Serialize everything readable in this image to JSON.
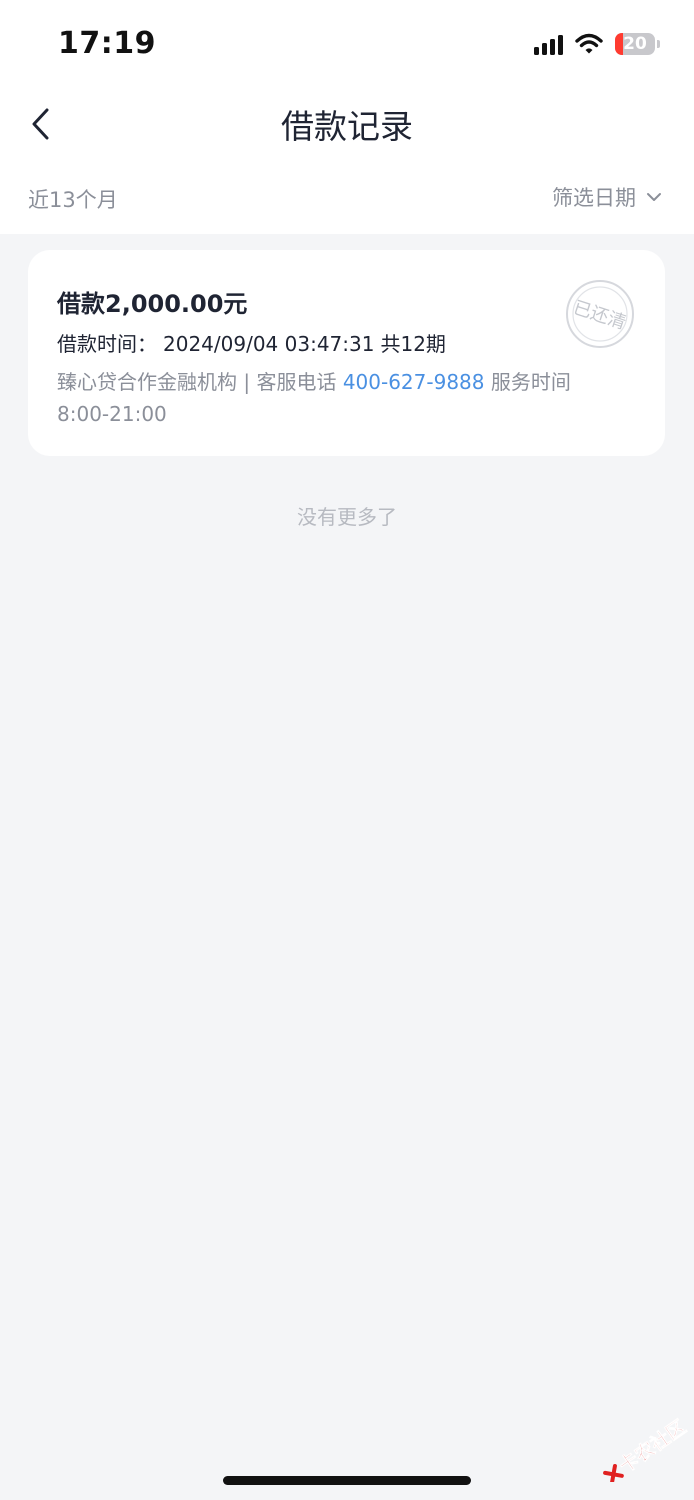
{
  "status": {
    "time": "17:19",
    "battery": "20",
    "battery_level": 0.2
  },
  "nav": {
    "title": "借款记录"
  },
  "filter": {
    "range": "近13个月",
    "date_filter": "筛选日期"
  },
  "loan": {
    "amount": "借款2,000.00元",
    "time_label": "借款时间：",
    "time_value": "2024/09/04 03:47:31",
    "periods": "共12期",
    "institution": "臻心贷合作金融机构 | 客服电话 ",
    "phone": "400-627-9888",
    "service_hours": " 服务时间8:00-21:00",
    "stamp": "已还清"
  },
  "footer": {
    "no_more": "没有更多了"
  },
  "watermark": {
    "text": "卡农社区"
  },
  "colors": {
    "accent": "#4a90e2",
    "muted": "#8b8f99",
    "background": "#f4f5f7",
    "battery_low": "#ff3b30"
  }
}
